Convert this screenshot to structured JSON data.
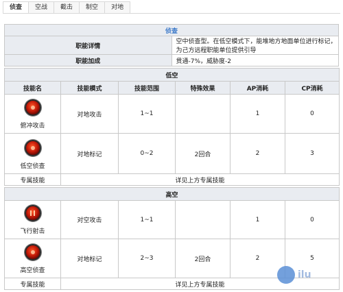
{
  "tabs": [
    "侦查",
    "空战",
    "截击",
    "制空",
    "对地"
  ],
  "info": {
    "title": "侦查",
    "rows": [
      {
        "label": "职能详情",
        "value": "空中侦查型。在低空模式下，能堆地方地面单位进行标记，为己方远程职能单位提供引导"
      },
      {
        "label": "职能加成",
        "value": "贯通-7%，威胁度-2"
      }
    ]
  },
  "columns": [
    "技能名",
    "技能模式",
    "技能范围",
    "特殊效果",
    "AP消耗",
    "CP消耗"
  ],
  "low": {
    "title": "低空",
    "skills": [
      {
        "name": "俯冲攻击",
        "icon": "dive-attack-icon",
        "mode": "对地攻击",
        "range": "1~1",
        "effect": "",
        "ap": "1",
        "cp": "0"
      },
      {
        "name": "低空侦查",
        "icon": "low-recon-icon",
        "mode": "对地标记",
        "range": "0~2",
        "effect": "2回合",
        "ap": "2",
        "cp": "3"
      }
    ],
    "special_label": "专属技能",
    "special_value": "详见上方专属技能"
  },
  "high": {
    "title": "高空",
    "skills": [
      {
        "name": "飞行射击",
        "icon": "flight-shot-icon",
        "mode": "对空攻击",
        "range": "1~1",
        "effect": "",
        "ap": "1",
        "cp": "0"
      },
      {
        "name": "高空侦查",
        "icon": "high-recon-icon",
        "mode": "对地标记",
        "range": "2~3",
        "effect": "2回合",
        "ap": "2",
        "cp": "5"
      }
    ],
    "special_label": "专属技能",
    "special_value": "详见上方专属技能"
  },
  "watermark": "ilu"
}
